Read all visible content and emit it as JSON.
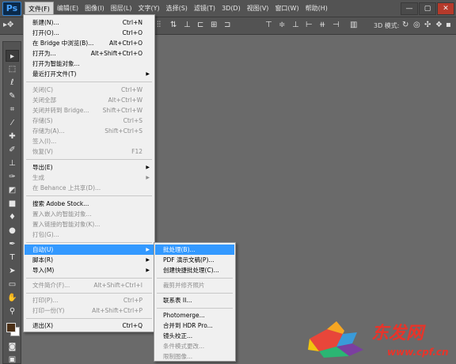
{
  "app": {
    "logo": "Ps"
  },
  "menubar": {
    "items": [
      "文件(F)",
      "编辑(E)",
      "图像(I)",
      "图层(L)",
      "文字(Y)",
      "选择(S)",
      "滤镜(T)",
      "3D(D)",
      "视图(V)",
      "窗口(W)",
      "帮助(H)"
    ],
    "active_index": 0,
    "window_controls": {
      "minimize": "—",
      "restore": "▢",
      "close": "✕"
    }
  },
  "options_bar": {
    "mode_label": "3D 模式:"
  },
  "file_menu": {
    "new": {
      "label": "新建(N)...",
      "shortcut": "Ctrl+N"
    },
    "open": {
      "label": "打开(O)...",
      "shortcut": "Ctrl+O"
    },
    "browse_bridge": {
      "label": "在 Bridge 中浏览(B)...",
      "shortcut": "Alt+Ctrl+O"
    },
    "open_as": {
      "label": "打开为...",
      "shortcut": "Alt+Shift+Ctrl+O"
    },
    "open_smart": {
      "label": "打开为智能对象..."
    },
    "recent": {
      "label": "最近打开文件(T)"
    },
    "close": {
      "label": "关闭(C)",
      "shortcut": "Ctrl+W"
    },
    "close_all": {
      "label": "关闭全部",
      "shortcut": "Alt+Ctrl+W"
    },
    "close_bridge": {
      "label": "关闭并转到 Bridge...",
      "shortcut": "Shift+Ctrl+W"
    },
    "save": {
      "label": "存储(S)",
      "shortcut": "Ctrl+S"
    },
    "save_as": {
      "label": "存储为(A)...",
      "shortcut": "Shift+Ctrl+S"
    },
    "checkin": {
      "label": "签入(I)..."
    },
    "revert": {
      "label": "恢复(V)",
      "shortcut": "F12"
    },
    "export": {
      "label": "导出(E)"
    },
    "generate": {
      "label": "生成"
    },
    "behance": {
      "label": "在 Behance 上共享(D)..."
    },
    "adobe_stock": {
      "label": "搜索 Adobe Stock..."
    },
    "place_embedded": {
      "label": "置入嵌入的智能对象..."
    },
    "place_linked": {
      "label": "置入链接的智能对象(K)..."
    },
    "package": {
      "label": "打包(G)..."
    },
    "automate": {
      "label": "自动(U)"
    },
    "scripts": {
      "label": "脚本(R)"
    },
    "import": {
      "label": "导入(M)"
    },
    "file_info": {
      "label": "文件简介(F)...",
      "shortcut": "Alt+Shift+Ctrl+I"
    },
    "print": {
      "label": "打印(P)...",
      "shortcut": "Ctrl+P"
    },
    "print_one": {
      "label": "打印一份(Y)",
      "shortcut": "Alt+Shift+Ctrl+P"
    },
    "exit": {
      "label": "退出(X)",
      "shortcut": "Ctrl+Q"
    }
  },
  "automate_menu": {
    "batch": "批处理(B)...",
    "pdf": "PDF 演示文稿(P)...",
    "droplet": "创建快捷批处理(C)...",
    "crop_straighten": "裁剪并修齐照片",
    "contact_sheet": "联系表 II...",
    "photomerge": "Photomerge...",
    "hdr": "合并到 HDR Pro...",
    "lens": "镜头校正...",
    "conditional": "条件模式更改...",
    "fit_image": "限制图像..."
  },
  "watermark": {
    "site_name": "东发网",
    "url": "www.cpf.cn"
  }
}
